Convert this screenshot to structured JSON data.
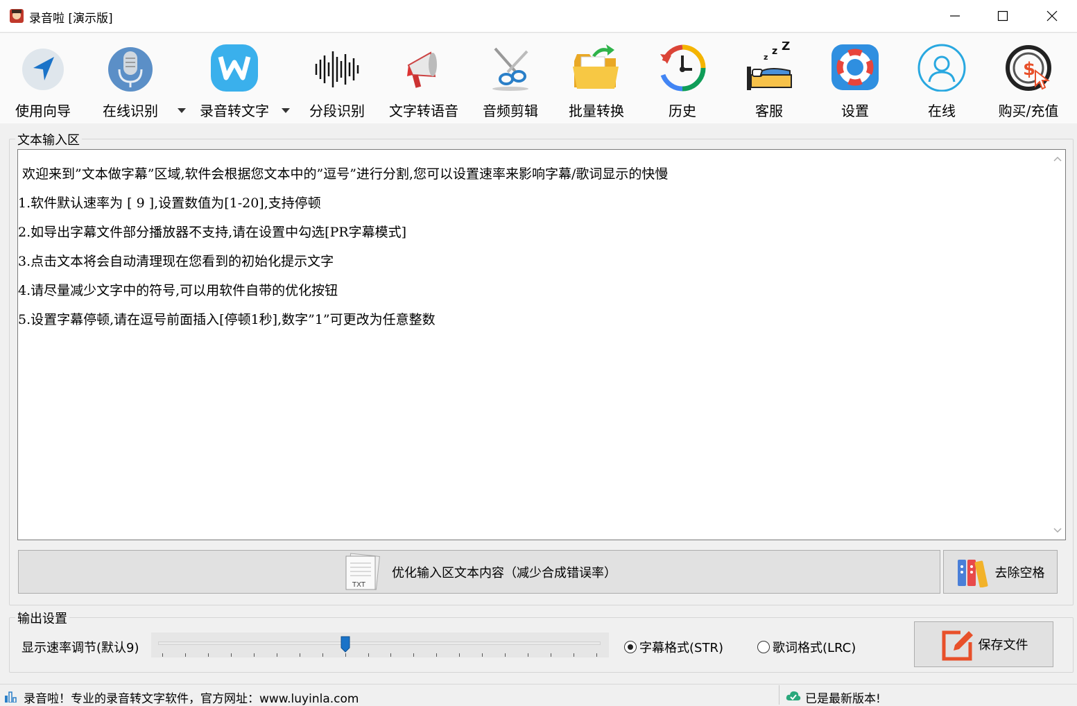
{
  "window": {
    "title": "录音啦 [演示版]"
  },
  "toolbar": {
    "items": [
      {
        "label": "使用向导",
        "icon": "navigation-arrow-icon"
      },
      {
        "label": "在线识别",
        "icon": "microphone-icon"
      },
      {
        "label": "录音转文字",
        "icon": "w-logo-icon"
      },
      {
        "label": "分段识别",
        "icon": "soundwave-icon"
      },
      {
        "label": "文字转语音",
        "icon": "megaphone-icon"
      },
      {
        "label": "音频剪辑",
        "icon": "scissors-icon"
      },
      {
        "label": "批量转换",
        "icon": "folder-icon"
      },
      {
        "label": "历史",
        "icon": "clock-history-icon"
      },
      {
        "label": "客服",
        "icon": "sleeping-bed-icon"
      },
      {
        "label": "设置",
        "icon": "lifebuoy-icon"
      },
      {
        "label": "在线",
        "icon": "user-circle-icon"
      },
      {
        "label": "购买/充值",
        "icon": "dollar-cursor-icon"
      }
    ]
  },
  "input_area": {
    "group_title": "文本输入区",
    "lines": [
      " 欢迎来到”文本做字幕”区域,软件会根据您文本中的”逗号”进行分割,您可以设置速率来影响字幕/歌词显示的快慢",
      "1.软件默认速率为 [ 9 ],设置数值为[1-20],支持停顿",
      "2.如导出字幕文件部分播放器不支持,请在设置中勾选[PR字幕模式]",
      "3.点击文本将会自动清理现在您看到的初始化提示文字",
      "4.请尽量减少文字中的符号,可以用软件自带的优化按钮",
      "5.设置字幕停顿,请在逗号前面插入[停顿1秒],数字”1”可更改为任意整数"
    ],
    "optimize_button": "优化输入区文本内容（减少合成错误率）",
    "optimize_icon_text": "TXT",
    "remove_spaces_button": "去除空格"
  },
  "output": {
    "group_title": "输出设置",
    "speed_label": "显示速率调节(默认9)",
    "speed_value": 9,
    "speed_min": 1,
    "speed_max": 20,
    "format_options": [
      {
        "label": "字幕格式(STR)",
        "selected": true
      },
      {
        "label": "歌词格式(LRC)",
        "selected": false
      }
    ],
    "save_button": "保存文件"
  },
  "status": {
    "left_text": "录音啦！专业的录音转文字软件，官方网址：www.luyinla.com",
    "right_text": "已是最新版本!"
  },
  "colors": {
    "accent_blue": "#1a73c8",
    "save_icon_orange": "#e8502a"
  }
}
